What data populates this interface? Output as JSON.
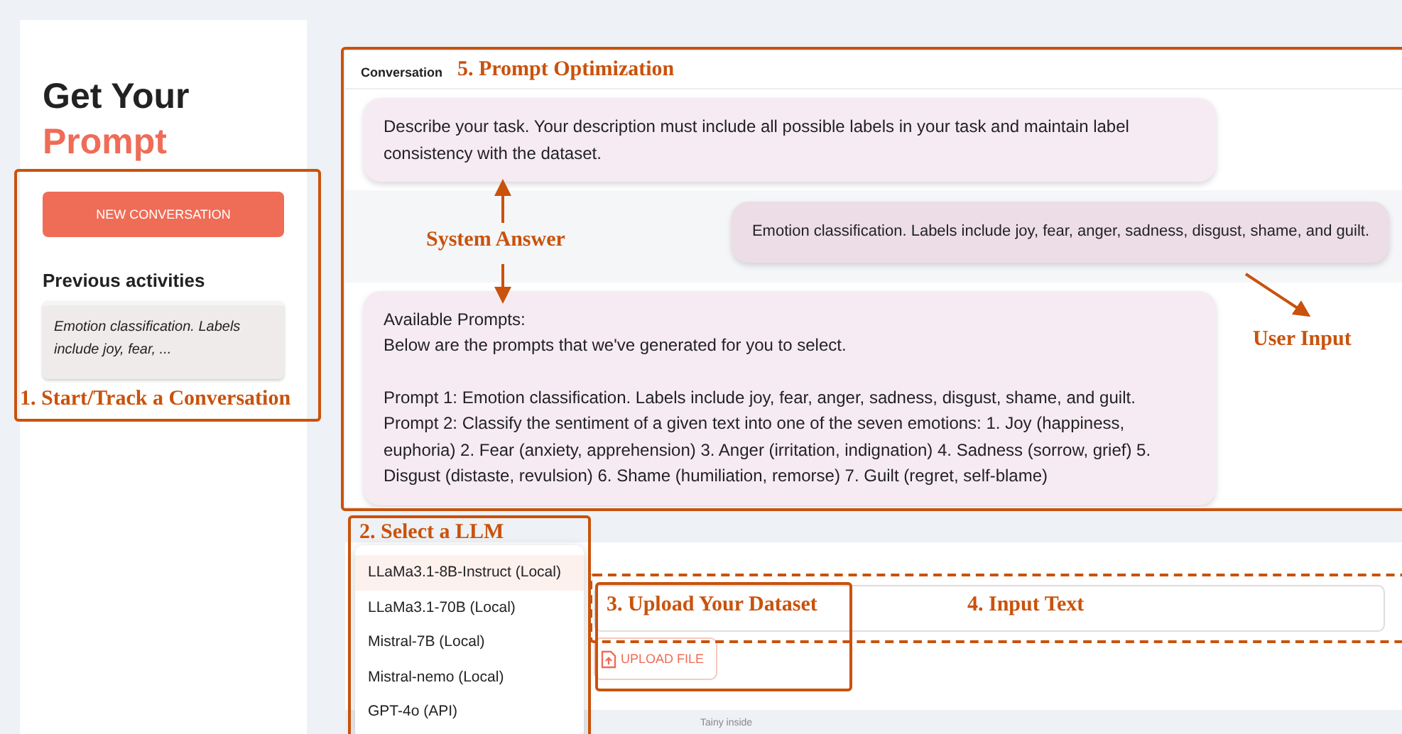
{
  "sidebar": {
    "title_line_1": "Get Your",
    "title_line_2": "Prompt",
    "new_button": "NEW CONVERSATION",
    "section_title": "Previous activities",
    "history": [
      {
        "text": "Emotion classification. Labels include joy, fear, ..."
      }
    ]
  },
  "conversation": {
    "tab": {
      "label": "Conversation",
      "selected": true
    },
    "messages": [
      {
        "kind": "system",
        "paragraphs": [
          [
            "Describe your task. Your description must include all possible labels in your task and maintain label consistency with the dataset."
          ]
        ]
      },
      {
        "kind": "user",
        "paragraphs": [
          [
            "Emotion classification. Labels include joy, fear, anger, sadness, disgust, shame, and guilt."
          ]
        ]
      },
      {
        "kind": "system",
        "paragraphs": [
          [
            "Available Prompts:",
            "Below are the prompts that we've generated for you to select."
          ],
          [
            "Prompt 1: Emotion classification. Labels include joy, fear, anger, sadness, disgust, shame, and guilt.",
            "Prompt 2: Classify the sentiment of a given text into one of the seven emotions:   1. Joy (happiness, euphoria) 2. Fear (anxiety, apprehension) 3. Anger (irritation, indignation) 4. Sadness (sorrow, grief) 5. Disgust (distaste, revulsion) 6. Shame (humiliation, remorse) 7. Guilt (regret, self-blame)"
          ]
        ]
      }
    ]
  },
  "input": {
    "upload_button": "UPLOAD FILE"
  },
  "model_menu": {
    "items": [
      {
        "label": "LLaMa3.1-8B-Instruct (Local)",
        "selected": true
      },
      {
        "label": "LLaMa3.1-70B (Local)",
        "selected": false
      },
      {
        "label": "Mistral-7B (Local)",
        "selected": false
      },
      {
        "label": "Mistral-nemo (Local)",
        "selected": false
      },
      {
        "label": "GPT-4o (API)",
        "selected": false
      }
    ]
  },
  "footer": "Tainy inside",
  "annotations": [
    {
      "kind": "box",
      "label": "1. Start/Track a Conversation"
    },
    {
      "kind": "box",
      "label": "5. Prompt Optimization"
    },
    {
      "kind": "arrows",
      "label": "System Answer"
    },
    {
      "kind": "arrow",
      "label": "User Input"
    },
    {
      "kind": "box",
      "label": "2. Select a LLM"
    },
    {
      "kind": "box",
      "label": "3. Upload Your Dataset"
    },
    {
      "kind": "dashed",
      "label": "4. Input Text"
    }
  ]
}
